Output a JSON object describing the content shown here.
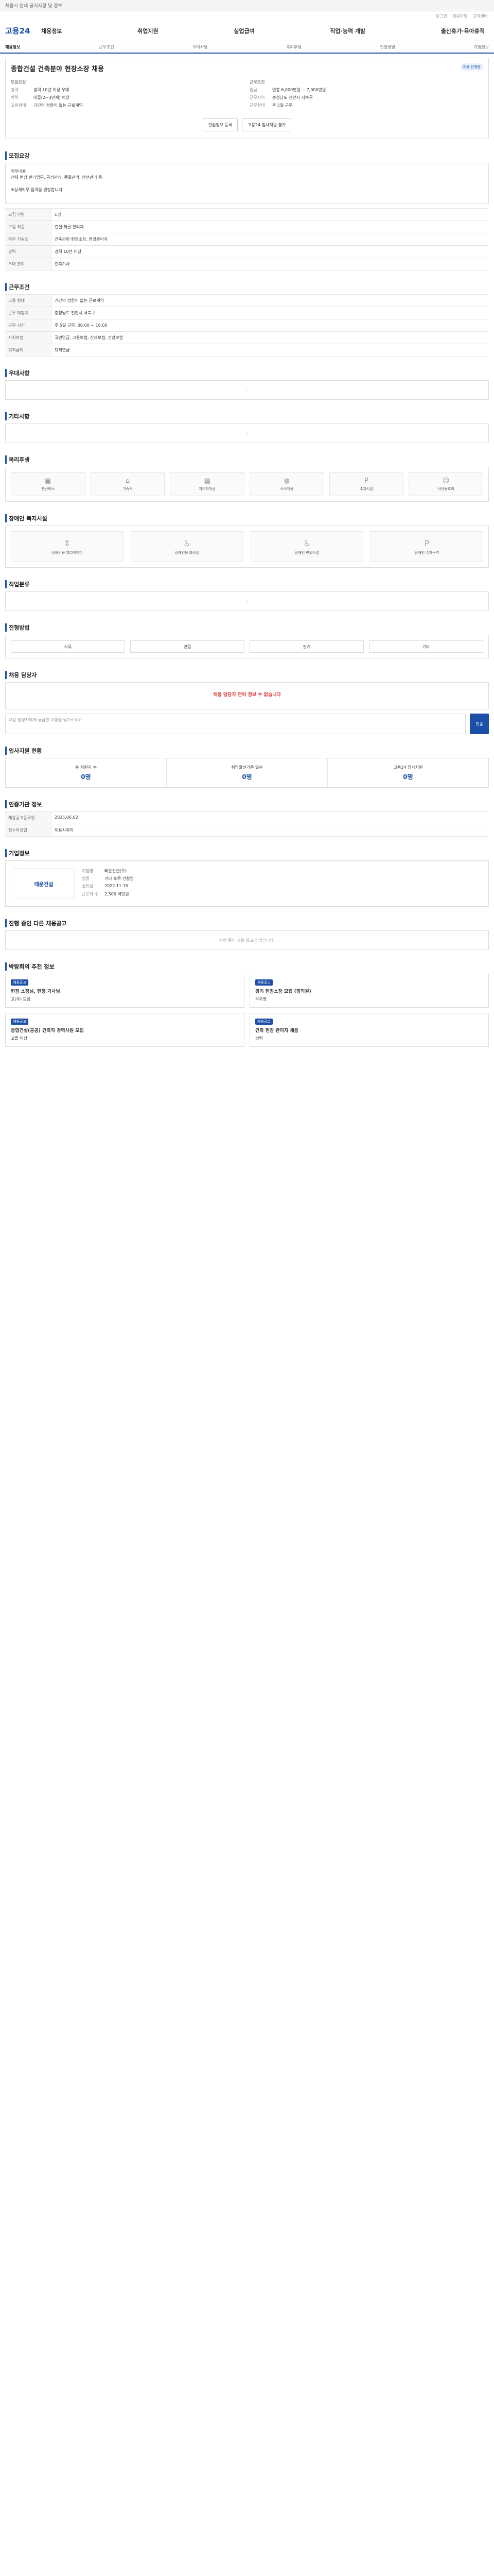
{
  "top": {
    "notice": "채용시 안내 공지사항 및 정보",
    "util": [
      "로그인",
      "회원가입",
      "고객센터"
    ]
  },
  "gnb": {
    "logo": "고용24",
    "items": [
      "채용정보",
      "취업지원",
      "실업급여",
      "직업·능력 개발",
      "출산휴가·육아휴직"
    ]
  },
  "subnav": {
    "items": [
      "채용정보",
      "근무조건",
      "우대사항",
      "복리후생",
      "전형방법",
      "기업정보"
    ]
  },
  "job": {
    "title": "종합건설 건축분야 현장소장 채용",
    "badge": "채용 진행중",
    "company_name": "종합건설",
    "left_label": "모집요강",
    "right_label": "근무조건",
    "info": [
      {
        "k": "경력",
        "v": "경력 10년 이상 우대"
      },
      {
        "k": "학력",
        "v": "대졸(2~3년제) 이상"
      },
      {
        "k": "고용형태",
        "v": "기간의 정함이 없는 근로계약"
      }
    ],
    "info2": [
      {
        "k": "임금",
        "v": "연봉 6,000만원 ~ 7,000만원"
      },
      {
        "k": "근무지역",
        "v": "충청남도 천안시 서북구"
      },
      {
        "k": "근무형태",
        "v": "주 5일 근무"
      }
    ],
    "btn_scrap": "관심정보 등록",
    "btn_apply": "고용24 입사지원 불가"
  },
  "sections": {
    "recruit": "모집요강",
    "work": "근무조건",
    "pref": "우대사항",
    "etc": "기타사항",
    "welfare": "복리후생",
    "disability": "장애인 복지시설",
    "major": "직업분류",
    "how": "전형방법",
    "manager": "채용 담당자",
    "stats": "입사지원 현황",
    "info": "인증기관 정보",
    "company": "기업정보",
    "other": "진행 중인 다른 채용공고",
    "recommend": "박람회의 추천 정보"
  },
  "duty": "직무내용\n전체 현장 관리업무, 공정관리, 품질관리, 안전관리 등\n\n※상세직무 입력을 권장합니다.",
  "recruit_rows": [
    {
      "th": "모집 인원",
      "td": "1명"
    },
    {
      "th": "모집 직종",
      "td": "건설·채굴 관리자"
    },
    {
      "th": "직무 키워드",
      "td": "건축관련 현장소장, 현장관리자"
    },
    {
      "th": "경력",
      "td": "경력 10년 이상"
    },
    {
      "th": "우대 분야",
      "td": "건축기사"
    }
  ],
  "work_rows": [
    {
      "th": "고용 형태",
      "td": "기간의 정함이 없는 근로계약"
    },
    {
      "th": "근무 예정지",
      "td": "충청남도 천안시 서북구"
    },
    {
      "th": "근무 시간",
      "td": "주 5일 근무, 09:00 ~ 18:00"
    },
    {
      "th": "사회보험",
      "td": "국민연금, 고용보험, 산재보험, 건강보험"
    },
    {
      "th": "퇴직급여",
      "td": "퇴직연금"
    }
  ],
  "welfare": [
    "통근버스",
    "기숙사",
    "자녀학자금",
    "식사제공",
    "주차시설",
    "사내동호회"
  ],
  "disability": [
    "장애인용 엘리베이터",
    "장애인용 화장실",
    "장애인 편의시설",
    "장애인 주차구역"
  ],
  "how_tabs": [
    "서류",
    "면접",
    "필기",
    "기타"
  ],
  "manager_alert": "채용 담당자 연락 정보 수 없습니다",
  "chat_placeholder": "채용 담당자에게 궁금한 사항을 남겨주세요.",
  "chat_btn": "전송",
  "stats": [
    {
      "l": "총 지원자 수",
      "v": "0명"
    },
    {
      "l": "취업알선기준 일수",
      "v": "0명"
    },
    {
      "l": "고용24 입사지원",
      "v": "0명"
    }
  ],
  "cert_rows": [
    {
      "th": "채용공고등록일",
      "td": "2025.06.02"
    },
    {
      "th": "접수마감일",
      "td": "채용시까지"
    }
  ],
  "company": {
    "logo": "태운건설",
    "rows": [
      {
        "k": "기업명",
        "v": "태운건설(주)"
      },
      {
        "k": "업종",
        "v": "기타 토목 건설업"
      },
      {
        "k": "설립일",
        "v": "2022.11.15"
      },
      {
        "k": "근로자 수",
        "v": "2,500 백만원"
      }
    ]
  },
  "other_empty": "진행 중인 채용 공고가 없습니다.",
  "recommend": [
    {
      "tag": "채용공고",
      "t": "현장 소장님, 현장 기사님",
      "s": "고(주) 모집"
    },
    {
      "tag": "채용공고",
      "t": "경기 현장소장 모집 (정직원)",
      "s": "무주명"
    },
    {
      "tag": "채용공고",
      "t": "종합건설(공공) 건축직 경력사원 모집",
      "s": "고졸 이상"
    },
    {
      "tag": "채용공고",
      "t": "건축 현장 관리자 채용",
      "s": "경력"
    }
  ]
}
